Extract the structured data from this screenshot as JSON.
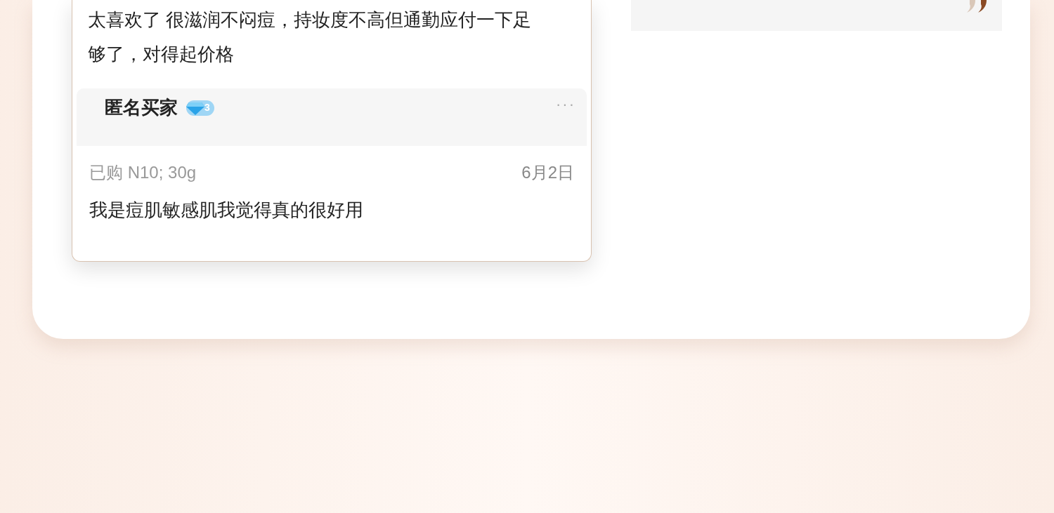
{
  "reviews": [
    {
      "text": "太喜欢了 很滋润不闷痘，持妆度不高但通勤应付一下足够了，对得起价格"
    },
    {
      "user": "匿名买家",
      "badge": "3",
      "menu": "···",
      "purchase": "已购 N10; 30g",
      "date": "6月2日",
      "text": "我是痘肌敏感肌我觉得真的很好用"
    }
  ]
}
